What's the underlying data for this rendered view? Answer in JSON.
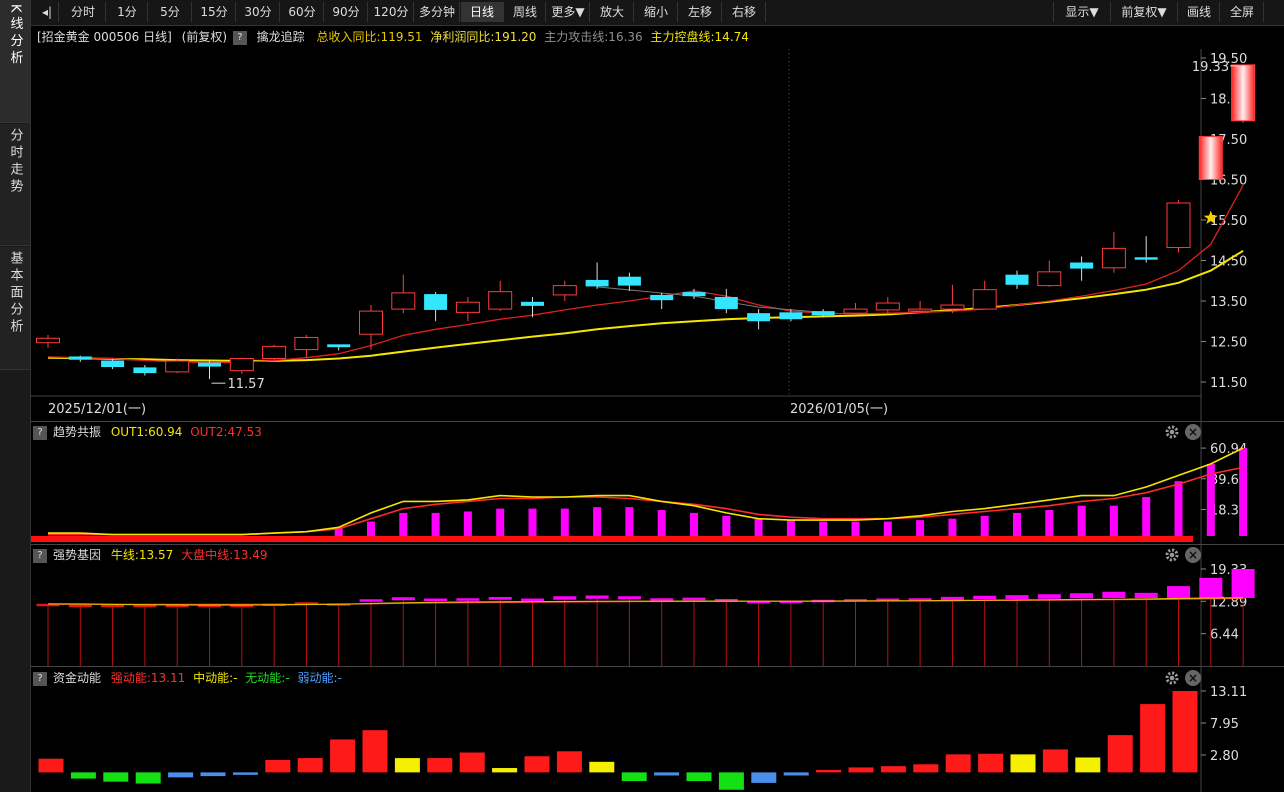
{
  "rail": {
    "tabs": [
      {
        "label": "K线分析",
        "active": true
      },
      {
        "label": "分时走势",
        "active": false
      },
      {
        "label": "基本面分析",
        "active": false
      }
    ]
  },
  "toolbar": {
    "back_icon": "collapse-left-icon",
    "periods": [
      "分时",
      "1分",
      "5分",
      "15分",
      "30分",
      "60分",
      "90分",
      "120分",
      "多分钟",
      "日线",
      "周线",
      "更多▼"
    ],
    "active_period": "日线",
    "actions": [
      "放大",
      "缩小",
      "左移",
      "右移"
    ],
    "right": [
      "显示▼",
      "前复权▼",
      "画线",
      "全屏"
    ]
  },
  "info": {
    "stock": "[招金黄金 000506 日线]",
    "fq": "(前复权)",
    "indicator": "擒龙追踪",
    "revenue": "总收入同比:119.51",
    "profit": "净利润同比:191.20",
    "attack": "主力攻击线:16.36",
    "control": "主力控盘线:14.74"
  },
  "colors": {
    "up": "#ff3b3b",
    "down": "#33e6ff",
    "ma_red": "#e02020",
    "ma_yellow": "#f5e600",
    "magenta": "#ff00ff",
    "grid": "#5a0000"
  },
  "main_chart": {
    "y_ticks": [
      "19.50",
      "18.50",
      "17.50",
      "16.50",
      "15.50",
      "14.50",
      "13.50",
      "12.50",
      "11.50"
    ],
    "high_label": "19.33",
    "low_label": "11.57",
    "dates": [
      "2025/12/01(一)",
      "2026/01/05(一)"
    ],
    "candles": [
      [
        12.47,
        12.58,
        12.35,
        12.66
      ],
      [
        12.13,
        12.05,
        12.0,
        12.15
      ],
      [
        12.03,
        11.87,
        11.82,
        12.07
      ],
      [
        11.86,
        11.72,
        11.66,
        11.92
      ],
      [
        11.75,
        12.02,
        11.72,
        12.08
      ],
      [
        11.98,
        11.88,
        11.57,
        12.03
      ],
      [
        11.78,
        12.08,
        11.7,
        12.1
      ],
      [
        12.08,
        12.38,
        12.0,
        12.42
      ],
      [
        12.3,
        12.6,
        12.1,
        12.66
      ],
      [
        12.43,
        12.36,
        12.28,
        12.4
      ],
      [
        12.68,
        13.25,
        12.3,
        13.4
      ],
      [
        13.3,
        13.7,
        13.2,
        14.15
      ],
      [
        13.67,
        13.28,
        13.0,
        13.72
      ],
      [
        13.22,
        13.47,
        13.0,
        13.6
      ],
      [
        13.3,
        13.73,
        13.25,
        14.0
      ],
      [
        13.48,
        13.38,
        13.1,
        13.6
      ],
      [
        13.65,
        13.88,
        13.5,
        14.0
      ],
      [
        14.02,
        13.86,
        13.8,
        14.45
      ],
      [
        14.1,
        13.88,
        13.75,
        14.2
      ],
      [
        13.65,
        13.52,
        13.3,
        13.7
      ],
      [
        13.72,
        13.62,
        13.55,
        13.8
      ],
      [
        13.6,
        13.3,
        13.2,
        13.8
      ],
      [
        13.2,
        13.0,
        12.8,
        13.3
      ],
      [
        13.22,
        13.05,
        13.0,
        13.3
      ],
      [
        13.25,
        13.15,
        13.1,
        13.3
      ],
      [
        13.2,
        13.3,
        13.15,
        13.45
      ],
      [
        13.28,
        13.45,
        13.2,
        13.6
      ],
      [
        13.3,
        13.3,
        13.2,
        13.5
      ],
      [
        13.3,
        13.4,
        13.2,
        13.9
      ],
      [
        13.3,
        13.78,
        13.3,
        14.0
      ],
      [
        14.15,
        13.9,
        13.8,
        14.25
      ],
      [
        13.88,
        14.22,
        13.85,
        14.5
      ],
      [
        14.45,
        14.3,
        14.0,
        14.6
      ],
      [
        14.32,
        14.8,
        14.2,
        15.2
      ],
      [
        14.58,
        14.52,
        14.45,
        15.1
      ],
      [
        14.82,
        15.92,
        14.7,
        16.0
      ],
      [
        16.5,
        17.56,
        16.5,
        17.56
      ],
      [
        17.95,
        19.33,
        17.9,
        19.33
      ]
    ],
    "ma_red": [
      12.12,
      12.1,
      12.08,
      12.03,
      12.0,
      11.98,
      11.99,
      12.03,
      12.1,
      12.2,
      12.4,
      12.65,
      12.8,
      12.92,
      13.05,
      13.15,
      13.28,
      13.4,
      13.5,
      13.62,
      13.75,
      13.62,
      13.4,
      13.25,
      13.2,
      13.18,
      13.2,
      13.22,
      13.25,
      13.3,
      13.4,
      13.5,
      13.62,
      13.76,
      13.92,
      14.25,
      14.9,
      16.36
    ],
    "ma_yellow": [
      12.1,
      12.09,
      12.07,
      12.06,
      12.04,
      12.03,
      12.02,
      12.02,
      12.04,
      12.08,
      12.15,
      12.25,
      12.35,
      12.44,
      12.53,
      12.62,
      12.7,
      12.8,
      12.88,
      12.95,
      13.0,
      13.05,
      13.08,
      13.1,
      13.12,
      13.14,
      13.17,
      13.22,
      13.27,
      13.33,
      13.4,
      13.48,
      13.57,
      13.67,
      13.78,
      13.95,
      14.25,
      14.74
    ]
  },
  "sub1": {
    "title": "趋势共振",
    "out1": "OUT1:60.94",
    "out2": "OUT2:47.53",
    "y_ticks": [
      "60.94",
      "39.66",
      "18.37"
    ],
    "bars": [
      0,
      0,
      0,
      0,
      0,
      0,
      0,
      0,
      0,
      6,
      10,
      16,
      16,
      17,
      19,
      19,
      19,
      20,
      20,
      18,
      16,
      14,
      12,
      11,
      10,
      10,
      10,
      11,
      12,
      14,
      16,
      18,
      21,
      21,
      27,
      38,
      50,
      61
    ],
    "line_yellow": [
      2,
      2,
      1,
      1,
      1,
      1,
      1,
      2,
      3,
      6,
      16,
      24,
      24,
      25,
      28,
      27,
      27,
      28,
      28,
      24,
      21,
      16,
      12,
      11,
      11,
      11,
      12,
      14,
      17,
      19,
      22,
      25,
      28,
      28,
      34,
      42,
      50,
      61
    ],
    "line_red": [
      1,
      1,
      1,
      1,
      1,
      1,
      1,
      2,
      3,
      5,
      12,
      19,
      22,
      24,
      26,
      26,
      27,
      27,
      26,
      24,
      22,
      19,
      15,
      13,
      12,
      12,
      12,
      13,
      15,
      17,
      19,
      21,
      24,
      26,
      30,
      36,
      43,
      47.53
    ]
  },
  "sub2": {
    "title": "强势基因",
    "niu": "牛线:13.57",
    "dapan": "大盘中线:13.49",
    "y_ticks": [
      "19.33",
      "12.89",
      "6.44"
    ],
    "bars": [
      12.4,
      12.15,
      11.95,
      11.82,
      12.05,
      12.05,
      12.1,
      12.45,
      12.7,
      12.5,
      13.3,
      13.7,
      13.45,
      13.5,
      13.75,
      13.45,
      13.9,
      14.05,
      13.9,
      13.5,
      13.62,
      13.35,
      13.0,
      13.05,
      13.2,
      13.32,
      13.45,
      13.5,
      13.78,
      14.0,
      14.12,
      14.3,
      14.5,
      14.8,
      14.58,
      15.92,
      17.56,
      19.33
    ],
    "base": [
      12.2,
      12.2,
      12.2,
      12.2,
      12.2,
      12.2,
      12.2,
      12.2,
      12.2,
      12.2,
      12.9,
      13.1,
      13.05,
      13.1,
      13.2,
      13.0,
      13.2,
      13.4,
      13.3,
      13.2,
      13.1,
      13.0,
      12.9,
      12.9,
      12.95,
      13.0,
      13.05,
      13.1,
      13.15,
      13.3,
      13.35,
      13.4,
      13.5,
      13.55,
      13.55,
      13.55,
      13.55,
      13.55
    ],
    "line_niu": [
      12.4,
      12.35,
      12.28,
      12.22,
      12.18,
      12.16,
      12.15,
      12.18,
      12.25,
      12.3,
      12.45,
      12.6,
      12.7,
      12.75,
      12.8,
      12.82,
      12.85,
      12.9,
      12.92,
      12.92,
      12.93,
      12.93,
      12.92,
      12.92,
      12.93,
      12.95,
      12.98,
      13.0,
      13.05,
      13.1,
      13.15,
      13.2,
      13.25,
      13.3,
      13.35,
      13.45,
      13.55,
      13.57
    ],
    "line_dp": [
      12.3,
      12.3,
      12.29,
      12.28,
      12.27,
      12.27,
      12.27,
      12.28,
      12.3,
      12.32,
      12.4,
      12.5,
      12.58,
      12.63,
      12.68,
      12.72,
      12.76,
      12.8,
      12.83,
      12.86,
      12.88,
      12.9,
      12.91,
      12.92,
      12.93,
      12.95,
      12.98,
      13.0,
      13.03,
      13.07,
      13.1,
      13.14,
      13.18,
      13.22,
      13.26,
      13.32,
      13.4,
      13.49
    ]
  },
  "sub3": {
    "title": "资金动能",
    "strong": "强动能:13.11",
    "mid": "中动能:-",
    "none": "无动能:-",
    "weak": "弱动能:-",
    "y_ticks": [
      "13.11",
      "7.95",
      "2.80"
    ],
    "bars": [
      [
        2.2,
        "r"
      ],
      [
        -1.0,
        "g"
      ],
      [
        -1.5,
        "g"
      ],
      [
        -1.8,
        "g"
      ],
      [
        -0.8,
        "b"
      ],
      [
        -0.6,
        "b"
      ],
      [
        -0.4,
        "b"
      ],
      [
        2.0,
        "r"
      ],
      [
        2.3,
        "r"
      ],
      [
        5.3,
        "r"
      ],
      [
        6.8,
        "r"
      ],
      [
        2.3,
        "y"
      ],
      [
        2.3,
        "r"
      ],
      [
        3.2,
        "r"
      ],
      [
        0.7,
        "y"
      ],
      [
        2.6,
        "r"
      ],
      [
        3.4,
        "r"
      ],
      [
        1.7,
        "y"
      ],
      [
        -1.4,
        "g"
      ],
      [
        -0.5,
        "b"
      ],
      [
        -1.4,
        "g"
      ],
      [
        -2.8,
        "g"
      ],
      [
        -1.7,
        "b"
      ],
      [
        -0.5,
        "b"
      ],
      [
        0.4,
        "r"
      ],
      [
        0.8,
        "r"
      ],
      [
        1.0,
        "r"
      ],
      [
        1.3,
        "r"
      ],
      [
        2.9,
        "r"
      ],
      [
        3.0,
        "r"
      ],
      [
        2.9,
        "y"
      ],
      [
        3.7,
        "r"
      ],
      [
        2.4,
        "y"
      ],
      [
        6.0,
        "r"
      ],
      [
        11.0,
        "r"
      ],
      [
        13.11,
        "r"
      ]
    ]
  }
}
